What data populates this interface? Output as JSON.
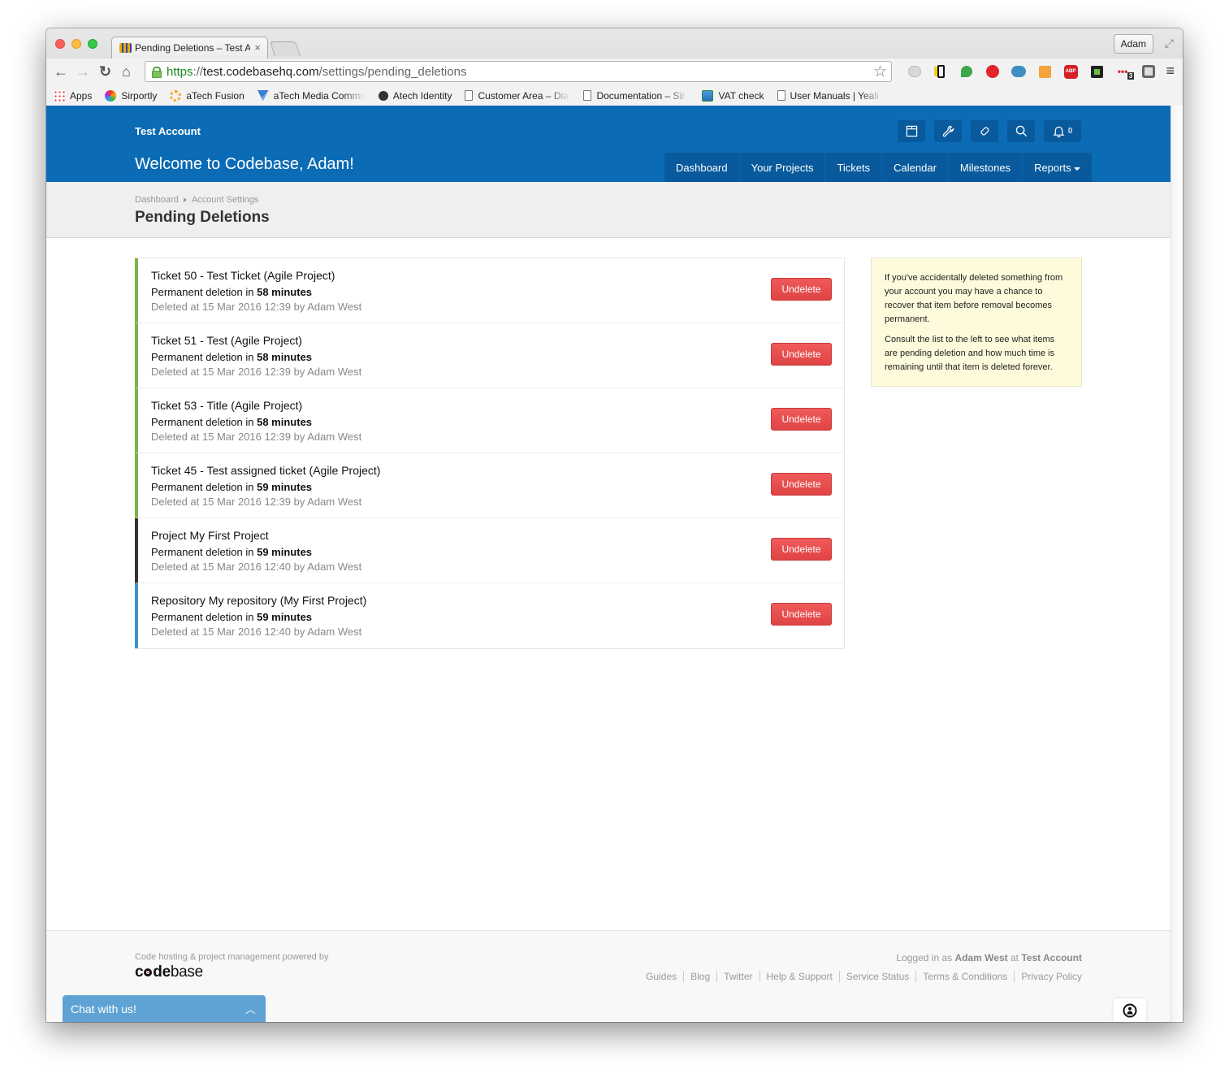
{
  "browser": {
    "tab_title": "Pending Deletions – Test A",
    "profile_name": "Adam",
    "url": {
      "scheme": "https",
      "separator": "://",
      "host": "test.codebasehq.com",
      "path": "/settings/pending_deletions"
    },
    "extensions": [
      "mailtrack-icon",
      "phone-forward-icon",
      "hangouts-icon",
      "adblock-hand-icon",
      "m-cloud-icon",
      "share-icon",
      "abp-icon",
      "green-dot-icon",
      "ellipsis-counter-icon",
      "shield-icon"
    ],
    "extension_badge": "3",
    "bookmarks": [
      {
        "label": "Apps",
        "icon": "apps-grid-icon"
      },
      {
        "label": "Sirportly",
        "icon": "sirportly-icon"
      },
      {
        "label": "aTech Fusion",
        "icon": "atech-fusion-icon"
      },
      {
        "label": "aTech Media Commu",
        "icon": "atech-media-icon"
      },
      {
        "label": "Atech Identity",
        "icon": "atech-identity-icon"
      },
      {
        "label": "Customer Area – Dia",
        "icon": "document-icon"
      },
      {
        "label": "Documentation – Sir",
        "icon": "document-icon"
      },
      {
        "label": "VAT check",
        "icon": "vat-icon"
      },
      {
        "label": "User Manuals | Yeali",
        "icon": "document-icon"
      }
    ]
  },
  "header": {
    "account_name": "Test Account",
    "welcome": "Welcome to Codebase, Adam!",
    "icons": [
      "projects-box-icon",
      "wrench-icon",
      "ticket-tag-icon",
      "search-icon",
      "bell-icon"
    ],
    "notification_count": "0",
    "nav": [
      "Dashboard",
      "Your Projects",
      "Tickets",
      "Calendar",
      "Milestones",
      "Reports"
    ]
  },
  "breadcrumb": [
    "Dashboard",
    "Account Settings"
  ],
  "page_title": "Pending Deletions",
  "deletions": [
    {
      "kind": "ticket",
      "title": "Ticket 50 - Test Ticket (Agile Project)",
      "countdown_prefix": "Permanent deletion in",
      "countdown": "58 minutes",
      "meta": "Deleted at 15 Mar 2016 12:39 by Adam West",
      "action": "Undelete"
    },
    {
      "kind": "ticket",
      "title": "Ticket 51 - Test (Agile Project)",
      "countdown_prefix": "Permanent deletion in",
      "countdown": "58 minutes",
      "meta": "Deleted at 15 Mar 2016 12:39 by Adam West",
      "action": "Undelete"
    },
    {
      "kind": "ticket",
      "title": "Ticket 53 - Title (Agile Project)",
      "countdown_prefix": "Permanent deletion in",
      "countdown": "58 minutes",
      "meta": "Deleted at 15 Mar 2016 12:39 by Adam West",
      "action": "Undelete"
    },
    {
      "kind": "ticket",
      "title": "Ticket 45 - Test assigned ticket (Agile Project)",
      "countdown_prefix": "Permanent deletion in",
      "countdown": "59 minutes",
      "meta": "Deleted at 15 Mar 2016 12:39 by Adam West",
      "action": "Undelete"
    },
    {
      "kind": "project",
      "title": "Project My First Project",
      "countdown_prefix": "Permanent deletion in",
      "countdown": "59 minutes",
      "meta": "Deleted at 15 Mar 2016 12:40 by Adam West",
      "action": "Undelete"
    },
    {
      "kind": "repository",
      "title": "Repository My repository (My First Project)",
      "countdown_prefix": "Permanent deletion in",
      "countdown": "59 minutes",
      "meta": "Deleted at 15 Mar 2016 12:40 by Adam West",
      "action": "Undelete"
    }
  ],
  "help": {
    "p1": "If you've accidentally deleted something from your account you may have a chance to recover that item before removal becomes permanent.",
    "p2": "Consult the list to the left to see what items are pending deletion and how much time is remaining until that item is deleted forever."
  },
  "footer": {
    "powered_by": "Code hosting & project management powered by",
    "logo_bold": "code",
    "logo_light": "base",
    "logged_in_prefix": "Logged in as",
    "logged_in_user": "Adam West",
    "logged_in_mid": "at",
    "logged_in_account": "Test Account",
    "links": [
      "Guides",
      "Blog",
      "Twitter",
      "Help & Support",
      "Service Status",
      "Terms & Conditions",
      "Privacy Policy"
    ]
  },
  "chat": {
    "label": "Chat with us!"
  },
  "colors": {
    "brand_blue": "#0b6bb5",
    "nav_blue": "#085a9c",
    "danger": "#e04444",
    "ticket_accent": "#7cb342",
    "project_accent": "#333333",
    "repository_accent": "#3a94c9",
    "help_bg": "#fdfbdb"
  }
}
